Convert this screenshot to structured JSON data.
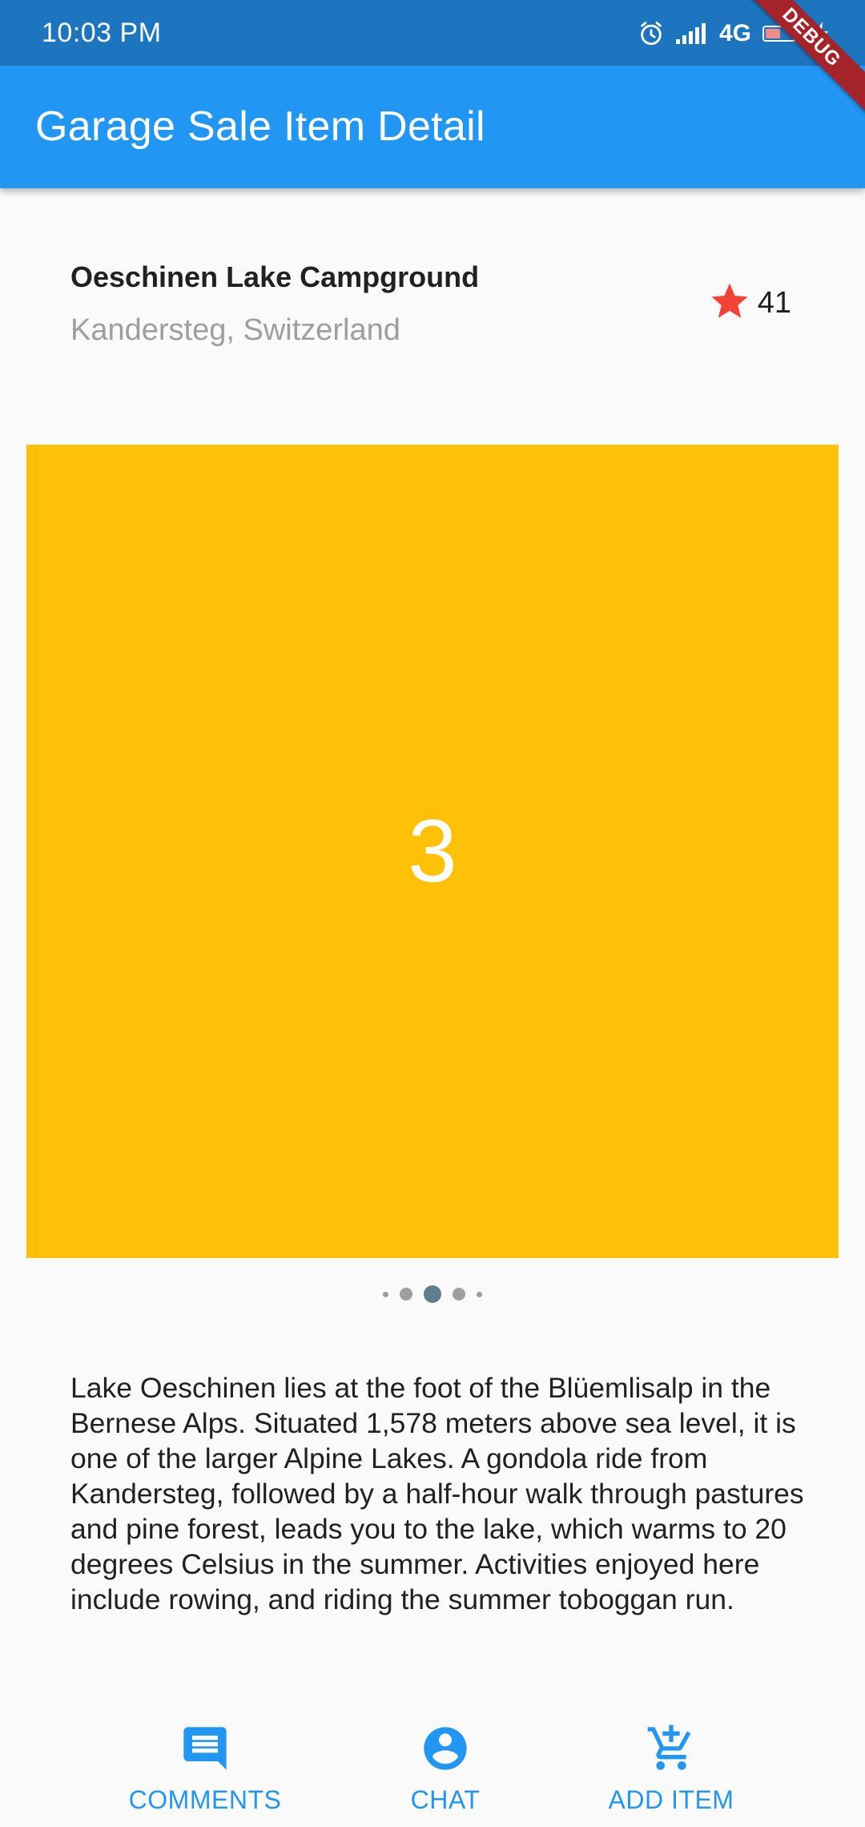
{
  "status_bar": {
    "time": "10:03 PM",
    "network": "4G",
    "icons": [
      "alarm-icon",
      "signal-icon",
      "battery-icon",
      "charging-icon"
    ]
  },
  "debug_banner": "DEBUG",
  "app_bar": {
    "title": "Garage Sale Item Detail"
  },
  "item": {
    "name": "Oeschinen Lake Campground",
    "location": "Kandersteg, Switzerland",
    "rating_count": "41",
    "rating_icon": "star-icon"
  },
  "carousel": {
    "current_label": "3",
    "slide_color": "#ffc107",
    "dots": 5,
    "active_dot": 3
  },
  "description": "Lake Oeschinen lies at the foot of the Blüemlisalp in the Bernese Alps. Situated 1,578 meters above sea level, it is one of the larger Alpine Lakes. A gondola ride from Kandersteg, followed by a half-hour walk through pastures and pine forest, leads you to the lake, which warms to 20 degrees Celsius in the summer. Activities enjoyed here include rowing, and riding the summer toboggan run.",
  "actions": [
    {
      "label": "COMMENTS",
      "icon": "comment-icon"
    },
    {
      "label": "CHAT",
      "icon": "account-circle-icon"
    },
    {
      "label": "ADD ITEM",
      "icon": "add-shopping-cart-icon"
    }
  ],
  "colors": {
    "status_bar": "#1e75bf",
    "app_bar": "#2196f3",
    "accent": "#2196f3",
    "star": "#f44336",
    "debug": "#a5242a"
  }
}
